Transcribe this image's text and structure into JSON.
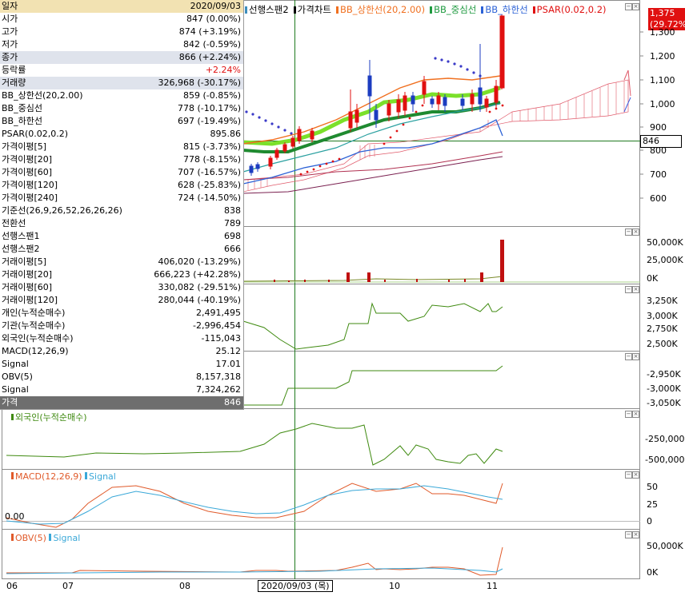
{
  "info": {
    "header": {
      "label": "일자",
      "value": "2020/09/03"
    },
    "rows": [
      {
        "label": "시가",
        "value": "847 (0.00%)"
      },
      {
        "label": "고가",
        "value": "874 (+3.19%)"
      },
      {
        "label": "저가",
        "value": "842 (-0.59%)"
      },
      {
        "label": "종가",
        "value": "866 (+2.24%)"
      },
      {
        "label": "등락률",
        "value": "+2.24%"
      },
      {
        "label": "거래량",
        "value": "326,968 (-30.17%)"
      },
      {
        "label": "BB_상한선(20,2.00)",
        "value": "859 (-0.85%)"
      },
      {
        "label": "BB_중심선",
        "value": "778 (-10.17%)"
      },
      {
        "label": "BB_하한선",
        "value": "697 (-19.49%)"
      },
      {
        "label": "PSAR(0.02,0.2)",
        "value": "895.86"
      },
      {
        "label": "가격이평[5]",
        "value": "815 (-3.73%)"
      },
      {
        "label": "가격이평[20]",
        "value": "778 (-8.15%)"
      },
      {
        "label": "가격이평[60]",
        "value": "707 (-16.57%)"
      },
      {
        "label": "가격이평[120]",
        "value": "628 (-25.83%)"
      },
      {
        "label": "가격이평[240]",
        "value": "724 (-14.50%)"
      },
      {
        "label": "기준선(26,9,26,52,26,26,26)",
        "value": "838"
      },
      {
        "label": "전환선",
        "value": "789"
      },
      {
        "label": "선행스팬1",
        "value": "698"
      },
      {
        "label": "선행스팬2",
        "value": "666"
      },
      {
        "label": "거래이평[5]",
        "value": "406,020 (-13.29%)"
      },
      {
        "label": "거래이평[20]",
        "value": "666,223 (+42.28%)"
      },
      {
        "label": "거래이평[60]",
        "value": "330,082 (-29.51%)"
      },
      {
        "label": "거래이평[120]",
        "value": "280,044 (-40.19%)"
      },
      {
        "label": "개인(누적순매수)",
        "value": "2,491,495"
      },
      {
        "label": "기관(누적순매수)",
        "value": "-2,996,454"
      },
      {
        "label": "외국인(누적순매수)",
        "value": "-115,043"
      },
      {
        "label": "MACD(12,26,9)",
        "value": "25.12"
      },
      {
        "label": "Signal",
        "value": "17.01"
      },
      {
        "label": "OBV(5)",
        "value": "8,157,318"
      },
      {
        "label": "Signal",
        "value": "7,324,262"
      }
    ],
    "footer": {
      "label": "가격",
      "value": "846"
    }
  },
  "legend": {
    "items": [
      {
        "label": "선행스팬2",
        "color": "#3c8dbc"
      },
      {
        "label": "가격차트",
        "color": "#000000"
      },
      {
        "label": "BB_상한선(20,2.00)",
        "color": "#f07020"
      },
      {
        "label": "BB_중심선",
        "color": "#1f9a40"
      },
      {
        "label": "BB_하한선",
        "color": "#2c62d6"
      },
      {
        "label": "PSAR(0.02,0.2)",
        "color": "#e01010"
      }
    ]
  },
  "price_axis": {
    "ticks": [
      "1,300",
      "1,200",
      "1,100",
      "1,000",
      "900",
      "800",
      "700",
      "600"
    ],
    "last_price_box": "1,375",
    "last_change_box": "(29.72%)",
    "cursor_price_box": "846"
  },
  "panels": {
    "volume": {
      "ticks": [
        "50,000K",
        "25,000K",
        "0K"
      ]
    },
    "individual": {
      "ticks": [
        "3,250K",
        "3,000K",
        "2,750K",
        "2,500K"
      ]
    },
    "institution": {
      "ticks": [
        "-2,950K",
        "-3,000K",
        "-3,050K"
      ]
    },
    "foreign": {
      "title": "외국인(누적순매수)",
      "ticks": [
        "-250,000",
        "-500,000"
      ]
    },
    "macd": {
      "title1": "MACD(12,26,9)",
      "title2": "Signal",
      "zero_label": "0.00",
      "ticks": [
        "50",
        "25",
        "0"
      ]
    },
    "obv": {
      "title1": "OBV(5)",
      "title2": "Signal",
      "ticks": [
        "50,000K",
        "0K"
      ]
    }
  },
  "x_axis": {
    "labels": [
      "06",
      "07",
      "08",
      "10",
      "11"
    ],
    "cursor_label": "2020/09/03 (목)"
  },
  "colors": {
    "up": "#e01010",
    "down": "#1c3cc0",
    "bb_band": "#7be02a",
    "grid_line": "#2a7a2a",
    "cloud_red": "#e05a6a",
    "cloud_blue": "#3a5ae0"
  }
}
